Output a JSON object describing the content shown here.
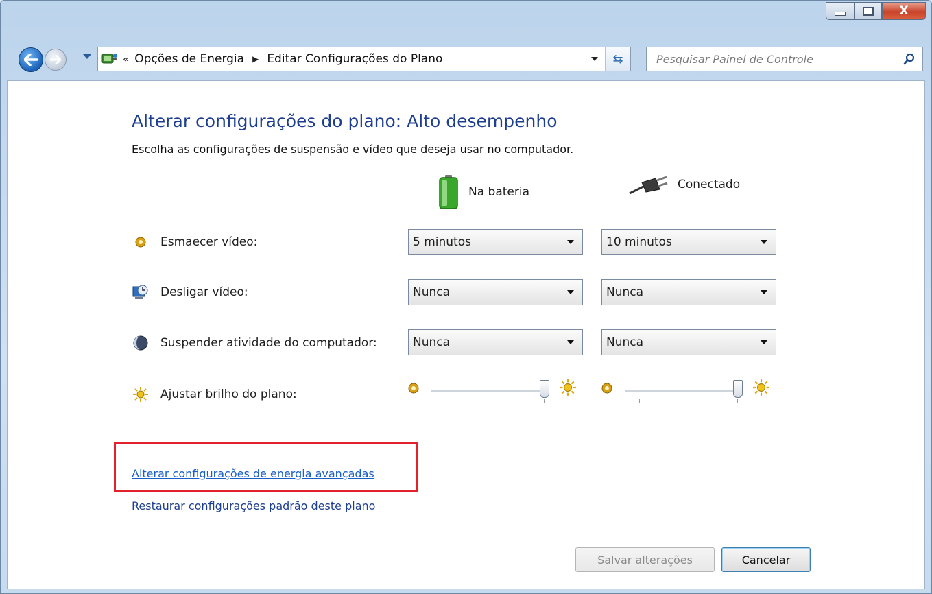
{
  "window": {
    "controls": {
      "minimize_icon": "minimize-icon",
      "maximize_icon": "maximize-icon",
      "close_label": "X"
    }
  },
  "nav": {
    "address_prefix": "«",
    "breadcrumbs": [
      "Opções de Energia",
      "Editar Configurações do Plano"
    ],
    "search_placeholder": "Pesquisar Painel de Controle"
  },
  "page": {
    "title": "Alterar configurações do plano: Alto desempenho",
    "subtitle": "Escolha as configurações de suspensão e vídeo que deseja usar no computador.",
    "columns": {
      "battery": "Na bateria",
      "plugged": "Conectado"
    },
    "rows": [
      {
        "label": "Esmaecer vídeo:",
        "icon": "dim-display-icon",
        "battery": "5 minutos",
        "plugged": "10 minutos"
      },
      {
        "label": "Desligar vídeo:",
        "icon": "display-off-icon",
        "battery": "Nunca",
        "plugged": "Nunca"
      },
      {
        "label": "Suspender atividade do computador:",
        "icon": "sleep-icon",
        "battery": "Nunca",
        "plugged": "Nunca"
      }
    ],
    "brightness": {
      "label": "Ajustar brilho do plano:",
      "battery_level": 1.0,
      "plugged_level": 1.0
    },
    "links": {
      "advanced": "Alterar configurações de energia avançadas",
      "restore": "Restaurar configurações padrão deste plano"
    },
    "buttons": {
      "save": "Salvar alterações",
      "cancel": "Cancelar"
    },
    "accent": "#1e3f8f",
    "highlight_color": "#e3212b"
  }
}
